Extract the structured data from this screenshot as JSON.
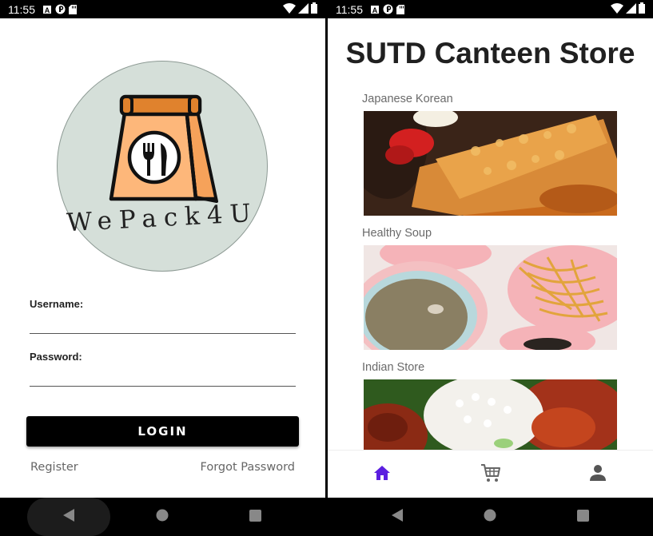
{
  "status_bar": {
    "time": "11:55"
  },
  "login_screen": {
    "logo_text": "WePack4U",
    "username_label": "Username:",
    "username_value": "",
    "password_label": "Password:",
    "password_value": "",
    "login_button": "LOGIN",
    "register_link": "Register",
    "forgot_link": "Forgot Password"
  },
  "store_screen": {
    "title": "SUTD Canteen Store",
    "stores": [
      {
        "name": "Japanese Korean"
      },
      {
        "name": "Healthy Soup"
      },
      {
        "name": "Indian Store"
      }
    ],
    "bottom_nav": {
      "active": "home",
      "accent_color": "#5b1ee0"
    }
  },
  "colors": {
    "logo_circle": "#d5dfd9",
    "bag": "#fdb77a",
    "bag_top": "#e0822d",
    "button": "#000000"
  }
}
